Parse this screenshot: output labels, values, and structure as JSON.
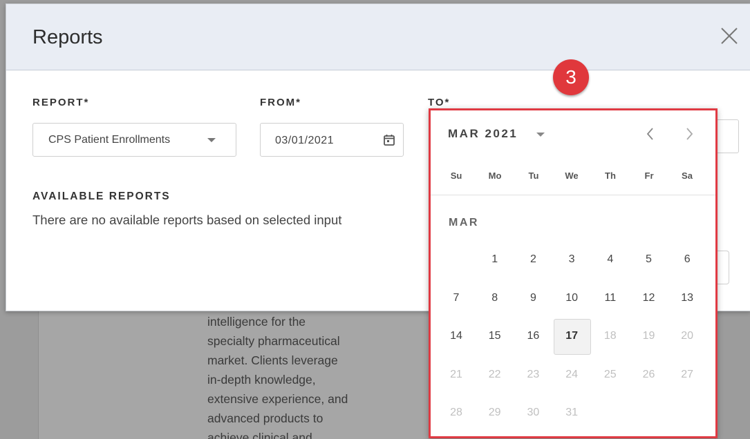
{
  "background": {
    "paragraph_lines": [
      "intelligence for the",
      "specialty pharmaceutical",
      "market. Clients leverage",
      "in-depth knowledge,",
      "extensive experience, and",
      "advanced products to",
      "achieve clinical and"
    ]
  },
  "modal": {
    "title": "Reports",
    "close_icon": "close-icon",
    "report": {
      "label": "REPORT*",
      "value": "CPS Patient Enrollments"
    },
    "from": {
      "label": "FROM*",
      "value": "03/01/2021"
    },
    "to": {
      "label": "TO*"
    },
    "available": {
      "label": "AVAILABLE REPORTS",
      "empty_text": "There are no available reports based on selected input"
    }
  },
  "callout": {
    "number": "3",
    "color": "#e0383c"
  },
  "datepicker": {
    "month_label": "MAR 2021",
    "sub_month": "MAR",
    "border_color": "#e03a43",
    "weekdays": [
      "Su",
      "Mo",
      "Tu",
      "We",
      "Th",
      "Fr",
      "Sa"
    ],
    "first_weekday_index": 1,
    "days_in_month": 31,
    "today": 17,
    "last_enabled_day": 17
  }
}
